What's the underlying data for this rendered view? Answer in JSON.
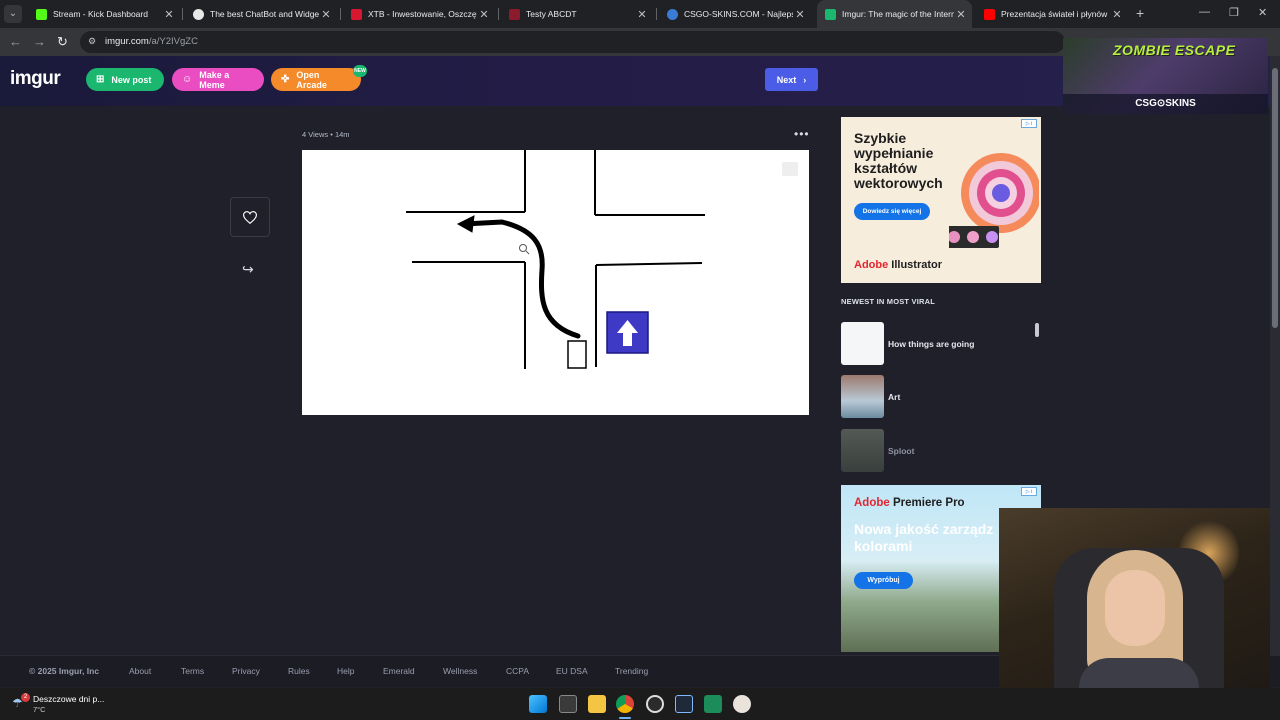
{
  "browser": {
    "tabs": [
      {
        "title": "Stream - Kick Dashboard",
        "favicon_color": "#53fc18"
      },
      {
        "title": "The best ChatBot and Widgets",
        "favicon_color": "#e8e8e8"
      },
      {
        "title": "XTB - Inwestowanie, Oszczędn",
        "favicon_color": "#d7172f"
      },
      {
        "title": "Testy ABCDT",
        "favicon_color": "#8b1a2b"
      },
      {
        "title": "CSGO-SKINS.COM - Najlepsze",
        "favicon_color": "#3a7bd5"
      },
      {
        "title": "Imgur: The magic of the Intern",
        "favicon_color": "#1bb76e"
      },
      {
        "title": "Prezentacja świateł i płynów Ku",
        "favicon_color": "#ff0000"
      }
    ],
    "active_tab_index": 5,
    "url_host": "imgur.com",
    "url_path": "/a/Y2IVgZC"
  },
  "imgur": {
    "logo": "imgur",
    "buttons": {
      "new_post": "New post",
      "make_meme": "Make a Meme",
      "open_arcade": "Open Arcade",
      "arcade_badge": "NEW",
      "next": "Next"
    },
    "post": {
      "views": "4 Views",
      "age": "14m"
    },
    "sidebar": {
      "ad1_title": "Szybkie wypełnianie kształtów wektorowych",
      "ad1_button": "Dowiedz się więcej",
      "ad1_brand_a": "Adobe",
      "ad1_brand_b": " Illustrator",
      "section_title": "NEWEST IN MOST VIRAL",
      "viral_items": [
        {
          "label": "How things are going"
        },
        {
          "label": "Art"
        },
        {
          "label": "Sploot"
        }
      ],
      "ad2_brand_a": "Adobe",
      "ad2_brand_b": " Premiere Pro",
      "ad2_title_1": "Nowa jakość zarządz",
      "ad2_title_2": "kolorami",
      "ad2_button": "Wypróbuj"
    },
    "footer": {
      "copyright": "© 2025 Imgur, Inc",
      "links": [
        "About",
        "Terms",
        "Privacy",
        "Rules",
        "Help",
        "Emerald",
        "Wellness",
        "CCPA",
        "EU DSA",
        "Trending"
      ]
    }
  },
  "overlay": {
    "game_title": "ZOMBIE ESCAPE",
    "sponsor": "CSG⊙SKINS"
  },
  "taskbar": {
    "weather_text": "Deszczowe dni p...",
    "temperature": "7°C",
    "notification_count": "2"
  }
}
